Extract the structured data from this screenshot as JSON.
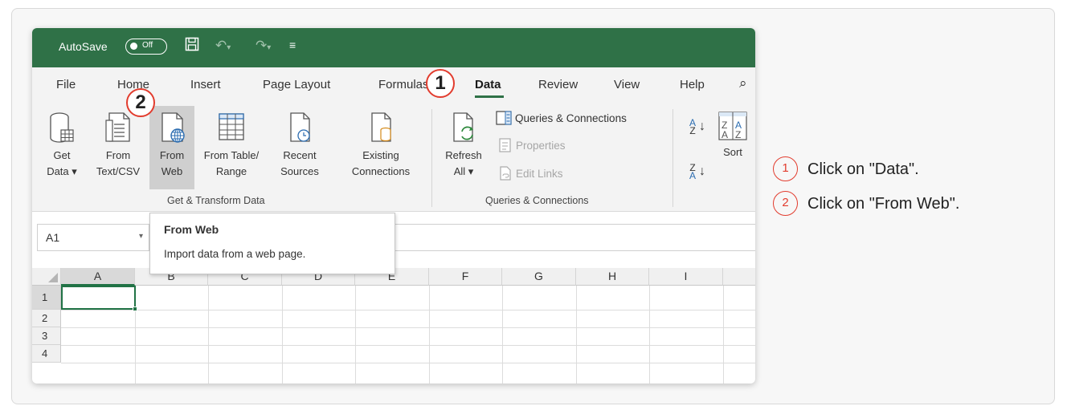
{
  "titlebar": {
    "autosave_label": "AutoSave",
    "autosave_state": "Off",
    "background": "#2f7147"
  },
  "tabs": [
    "File",
    "Home",
    "Insert",
    "Page Layout",
    "Formulas",
    "Data",
    "Review",
    "View",
    "Help"
  ],
  "active_tab": "Data",
  "ribbon": {
    "get_transform": {
      "buttons": [
        {
          "line1": "Get",
          "line2": "Data ▾"
        },
        {
          "line1": "From",
          "line2": "Text/CSV"
        },
        {
          "line1": "From",
          "line2": "Web"
        },
        {
          "line1": "From Table/",
          "line2": "Range"
        },
        {
          "line1": "Recent",
          "line2": "Sources"
        },
        {
          "line1": "Existing",
          "line2": "Connections"
        }
      ],
      "label": "Get & Transform Data"
    },
    "queries": {
      "refresh": {
        "line1": "Refresh",
        "line2": "All ▾"
      },
      "queries_connections": "Queries & Connections",
      "properties": "Properties",
      "edit_links": "Edit Links",
      "label": "Queries & Connections"
    },
    "sort": {
      "label": "Sort"
    }
  },
  "tooltip": {
    "title": "From Web",
    "body": "Import data from a web page."
  },
  "namebox": "A1",
  "columns": [
    "A",
    "B",
    "C",
    "D",
    "E",
    "F",
    "G",
    "H",
    "I"
  ],
  "rows": [
    "1",
    "2",
    "3",
    "4"
  ],
  "callouts": {
    "one": "1",
    "two": "2"
  },
  "steps": [
    {
      "num": "1",
      "text": "Click on \"Data\"."
    },
    {
      "num": "2",
      "text": "Click on \"From Web\"."
    }
  ],
  "colors": {
    "accent": "#e23c2e",
    "excel_green": "#217346"
  }
}
